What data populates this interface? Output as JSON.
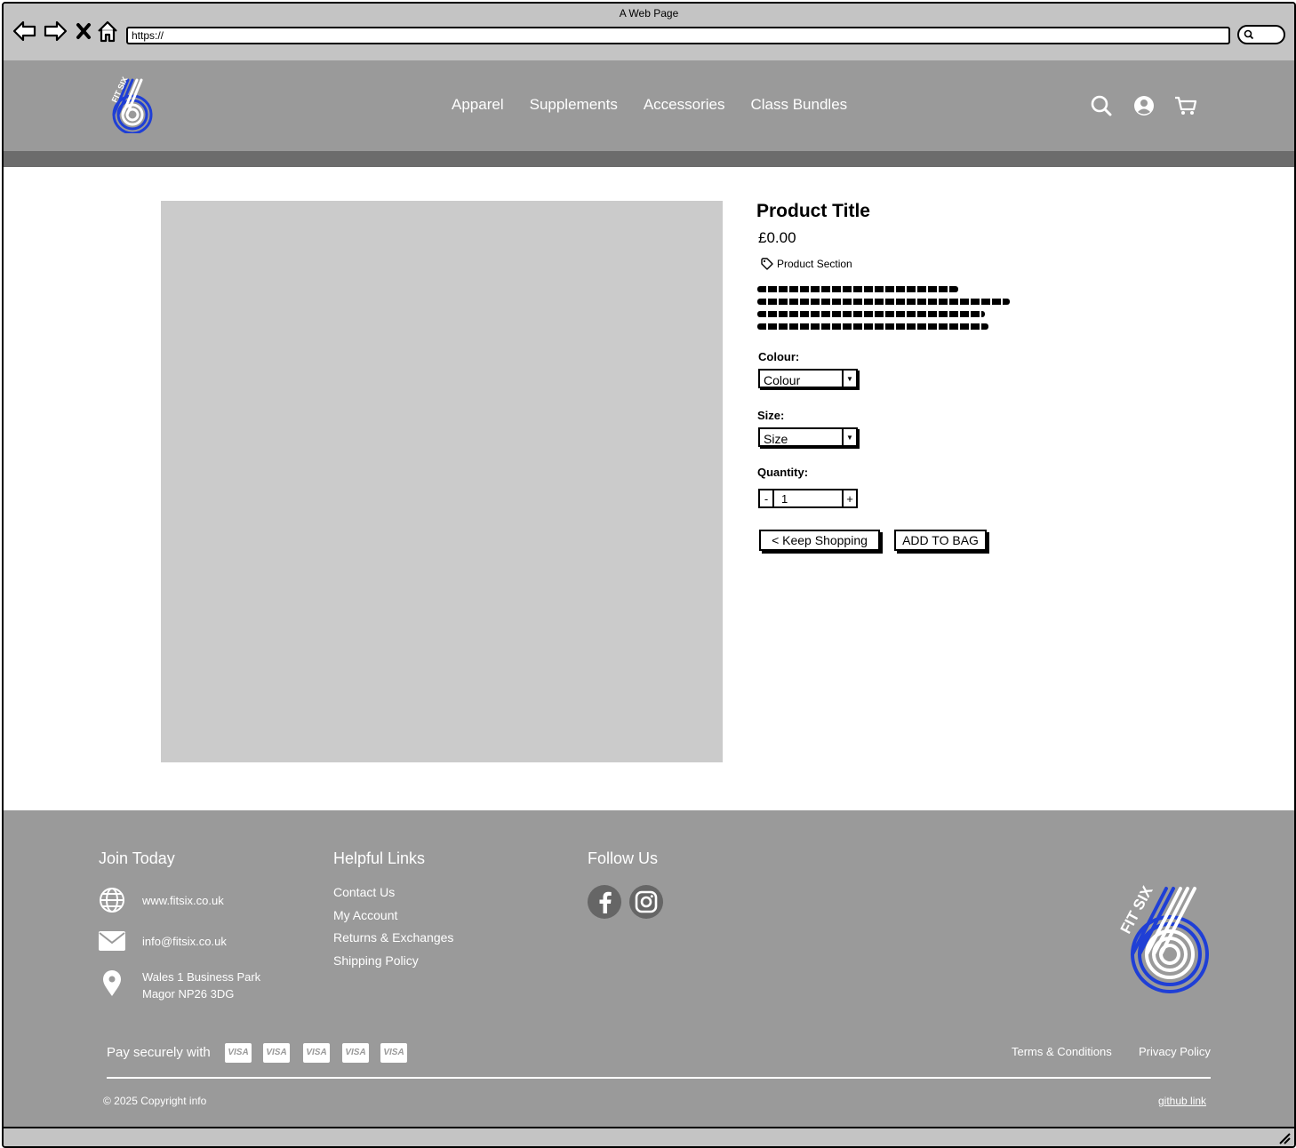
{
  "browser": {
    "window_title": "A Web Page",
    "url": "https://"
  },
  "header": {
    "nav": [
      "Apparel",
      "Supplements",
      "Accessories",
      "Class Bundles"
    ],
    "logo_text": "FIT SIX"
  },
  "product": {
    "title": "Product Title",
    "price": "£0.00",
    "section": "Product Section",
    "colour_label": "Colour:",
    "colour_value": "Colour",
    "size_label": "Size:",
    "size_value": "Size",
    "quantity_label": "Quantity:",
    "quantity_value": "1",
    "minus": "-",
    "plus": "+",
    "keep_shopping": "< Keep Shopping",
    "add_to_bag": "ADD TO BAG"
  },
  "footer": {
    "join_heading": "Join Today",
    "website": "www.fitsix.co.uk",
    "email": "info@fitsix.co.uk",
    "address_line1": "Wales 1 Business Park",
    "address_line2": "Magor NP26 3DG",
    "helpful_heading": "Helpful Links",
    "helpful_links": [
      "Contact Us",
      "My Account",
      "Returns & Exchanges",
      "Shipping Policy"
    ],
    "follow_heading": "Follow Us",
    "pay_label": "Pay securely with",
    "card_label": "VISA",
    "terms": "Terms & Conditions",
    "privacy": "Privacy Policy",
    "copyright": "© 2025 Copyright info",
    "github": "github link"
  },
  "colors": {
    "header_bg": "#9a9a9a",
    "header_strip": "#6c6c6c",
    "footer_bg": "#9a9a9a",
    "image_placeholder": "#cbcbcb",
    "logo_blue": "#1f3fd6"
  }
}
